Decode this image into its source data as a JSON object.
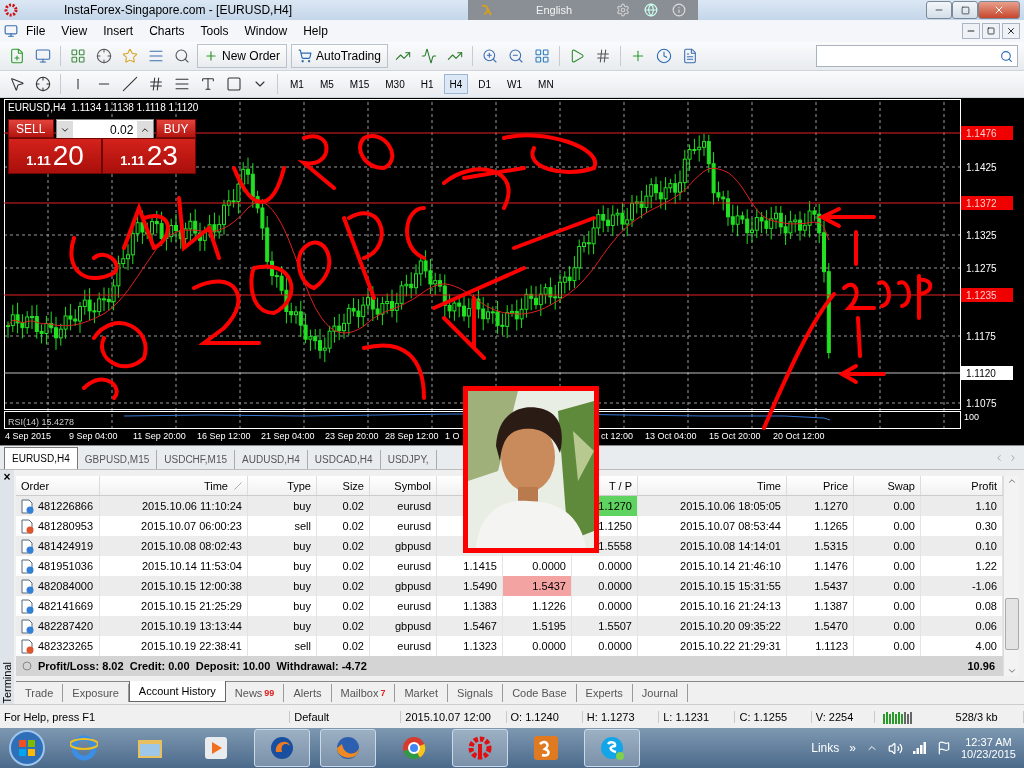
{
  "window": {
    "title": "InstaForex-Singapore.com - [EURUSD,H4]",
    "language": "English"
  },
  "menu": [
    "File",
    "View",
    "Insert",
    "Charts",
    "Tools",
    "Window",
    "Help"
  ],
  "toolbar": {
    "new_order": "New Order",
    "auto_trading": "AutoTrading"
  },
  "timeframes": [
    {
      "label": "M1",
      "selected": false
    },
    {
      "label": "M5",
      "selected": false
    },
    {
      "label": "M15",
      "selected": false
    },
    {
      "label": "M30",
      "selected": false
    },
    {
      "label": "H1",
      "selected": false
    },
    {
      "label": "H4",
      "selected": true
    },
    {
      "label": "D1",
      "selected": false
    },
    {
      "label": "W1",
      "selected": false
    },
    {
      "label": "MN",
      "selected": false
    }
  ],
  "chart": {
    "header": "EURUSD,H4  1.1134 1.1138 1.1118 1.1120",
    "lot": "0.02",
    "sell": {
      "label": "SELL",
      "price_big": "1.11",
      "price_pips": "20"
    },
    "buy": {
      "label": "BUY",
      "price_big": "1.11",
      "price_pips": "23"
    },
    "y_ticks": [
      "1.1425",
      "1.1325",
      "1.1275",
      "1.1175",
      "1.1075"
    ],
    "price_lines": [
      {
        "label": "1.1476",
        "kind": "alert"
      },
      {
        "label": "1.1372",
        "kind": "alert"
      },
      {
        "label": "1.1235",
        "kind": "alert"
      },
      {
        "label": "1.1120",
        "kind": "bid"
      }
    ],
    "x_labels": [
      "4 Sep 2015",
      "9 Sep 04:00",
      "11 Sep 20:00",
      "16 Sep 12:00",
      "21 Sep 04:00",
      "23 Sep 20:00",
      "28 Sep 12:00",
      "1 O",
      "ct 12:00",
      "13 Oct 04:00",
      "15 Oct 20:00",
      "20 Oct 12:00"
    ],
    "indicator": "RSI(14) 15.4278",
    "indicator_scale": "100"
  },
  "chart_tabs": [
    {
      "label": "EURUSD,H4",
      "selected": true
    },
    {
      "label": "GBPUSD,M15",
      "selected": false
    },
    {
      "label": "USDCHF,M15",
      "selected": false
    },
    {
      "label": "AUDUSD,H4",
      "selected": false
    },
    {
      "label": "USDCAD,H4",
      "selected": false
    },
    {
      "label": "USDJPY,",
      "selected": false
    }
  ],
  "terminal": {
    "title": "Terminal",
    "close": "×",
    "columns": [
      "Order",
      "Time",
      "Type",
      "Size",
      "Symbol",
      null,
      null,
      "T / P",
      "Time",
      "Price",
      "Swap",
      "Profit"
    ],
    "rows": [
      {
        "order": "481226866",
        "open_time": "2015.10.06 11:10:24",
        "type": "buy",
        "size": "0.02",
        "symbol": "eurusd",
        "price": null,
        "sl": null,
        "tp": "1.1270",
        "close_time": "2015.10.06 18:05:05",
        "close_price": "1.1270",
        "swap": "0.00",
        "profit": "1.10",
        "tp_hit": true,
        "color": "#2f80d6"
      },
      {
        "order": "481280953",
        "open_time": "2015.10.07 06:00:23",
        "type": "sell",
        "size": "0.02",
        "symbol": "eurusd",
        "price": null,
        "sl": null,
        "tp": "1.1250",
        "close_time": "2015.10.07 08:53:44",
        "close_price": "1.1265",
        "swap": "0.00",
        "profit": "0.30",
        "tp_hit": false,
        "color": "#e0562a"
      },
      {
        "order": "481424919",
        "open_time": "2015.10.08 08:02:43",
        "type": "buy",
        "size": "0.02",
        "symbol": "gbpusd",
        "price": null,
        "sl": null,
        "tp": "1.5558",
        "close_time": "2015.10.08 14:14:01",
        "close_price": "1.5315",
        "swap": "0.00",
        "profit": "0.10",
        "tp_hit": false,
        "color": "#2f80d6"
      },
      {
        "order": "481951036",
        "open_time": "2015.10.14 11:53:04",
        "type": "buy",
        "size": "0.02",
        "symbol": "eurusd",
        "price": "1.1415",
        "sl": "0.0000",
        "tp": "0.0000",
        "close_time": "2015.10.14 21:46:10",
        "close_price": "1.1476",
        "swap": "0.00",
        "profit": "1.22",
        "tp_hit": false,
        "sl_hit": false,
        "color": "#2f80d6"
      },
      {
        "order": "482084000",
        "open_time": "2015.10.15 12:00:38",
        "type": "buy",
        "size": "0.02",
        "symbol": "gbpusd",
        "price": "1.5490",
        "sl": "1.5437",
        "tp": "0.0000",
        "close_time": "2015.10.15 15:31:55",
        "close_price": "1.5437",
        "swap": "0.00",
        "profit": "-1.06",
        "tp_hit": false,
        "sl_hit": true,
        "color": "#2f80d6"
      },
      {
        "order": "482141669",
        "open_time": "2015.10.15 21:25:29",
        "type": "buy",
        "size": "0.02",
        "symbol": "eurusd",
        "price": "1.1383",
        "sl": "1.1226",
        "tp": "0.0000",
        "close_time": "2015.10.16 21:24:13",
        "close_price": "1.1387",
        "swap": "0.00",
        "profit": "0.08",
        "tp_hit": false,
        "sl_hit": false,
        "color": "#2f80d6"
      },
      {
        "order": "482287420",
        "open_time": "2015.10.19 13:13:44",
        "type": "buy",
        "size": "0.02",
        "symbol": "gbpusd",
        "price": "1.5467",
        "sl": "1.5195",
        "tp": "1.5507",
        "close_time": "2015.10.20 09:35:22",
        "close_price": "1.5470",
        "swap": "0.00",
        "profit": "0.06",
        "tp_hit": false,
        "sl_hit": false,
        "color": "#2f80d6"
      },
      {
        "order": "482323265",
        "open_time": "2015.10.19 22:38:41",
        "type": "sell",
        "size": "0.02",
        "symbol": "eurusd",
        "price": "1.1323",
        "sl": "0.0000",
        "tp": "0.0000",
        "close_time": "2015.10.22 21:29:31",
        "close_price": "1.1123",
        "swap": "0.00",
        "profit": "4.00",
        "tp_hit": false,
        "sl_hit": false,
        "color": "#e0562a"
      }
    ],
    "summary": "Profit/Loss: 8.02  Credit: 0.00  Deposit: 10.00  Withdrawal: -4.72",
    "total": "10.96",
    "tabs": [
      {
        "label": "Trade",
        "selected": false
      },
      {
        "label": "Exposure",
        "selected": false
      },
      {
        "label": "Account History",
        "selected": true
      },
      {
        "label": "News",
        "badge": "99",
        "selected": false
      },
      {
        "label": "Alerts",
        "selected": false
      },
      {
        "label": "Mailbox",
        "badge": "7",
        "selected": false
      },
      {
        "label": "Market",
        "selected": false
      },
      {
        "label": "Signals",
        "selected": false
      },
      {
        "label": "Code Base",
        "selected": false
      },
      {
        "label": "Experts",
        "selected": false
      },
      {
        "label": "Journal",
        "selected": false
      }
    ]
  },
  "status_bar": {
    "help": "For Help, press F1",
    "profile": "Default",
    "time": "2015.10.07 12:00",
    "open": "O: 1.1240",
    "high": "H: 1.1273",
    "low": "L: 1.1231",
    "close": "C: 1.1255",
    "volume": "V: 2254",
    "traffic": "528/3 kb"
  },
  "taskbar": {
    "links": "Links",
    "more": "»",
    "time": "12:37 AM",
    "date": "10/23/2015"
  }
}
